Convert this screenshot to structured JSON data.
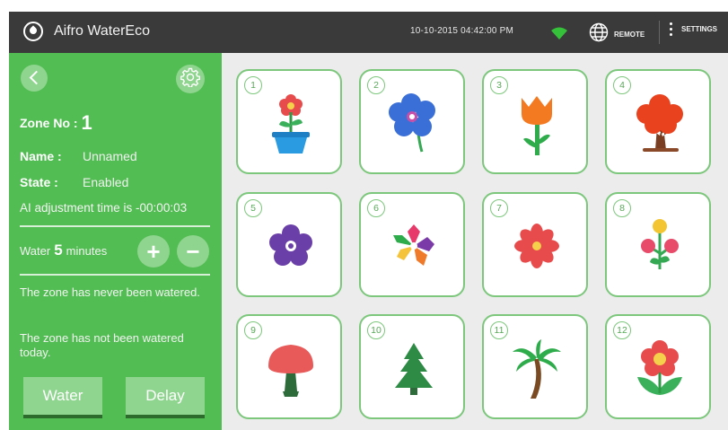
{
  "header": {
    "app_name": "Aifro WaterEco",
    "datetime": "10-10-2015  04:42:00  PM",
    "remote_label": "REMOTE",
    "settings_label": "SETTINGS"
  },
  "zone_panel": {
    "zone_label": "Zone No :",
    "zone_number": "1",
    "name_label": "Name :",
    "name_value": "Unnamed",
    "state_label": "State :",
    "state_value": "Enabled",
    "adjustment_text": "AI adjustment time is -00:00:03",
    "water_prefix": "Water",
    "water_minutes": "5",
    "water_suffix": "minutes",
    "plus_label": "+",
    "minus_label": "−",
    "never_watered_msg": "The zone has never been watered.",
    "not_today_msg": "The zone has not been watered today.",
    "water_button": "Water",
    "delay_button": "Delay"
  },
  "zones": [
    {
      "number": "1",
      "icon": "potted-flower-icon"
    },
    {
      "number": "2",
      "icon": "blue-flower-icon"
    },
    {
      "number": "3",
      "icon": "tulip-icon"
    },
    {
      "number": "4",
      "icon": "autumn-tree-icon"
    },
    {
      "number": "5",
      "icon": "purple-flower-icon"
    },
    {
      "number": "6",
      "icon": "star-flower-icon"
    },
    {
      "number": "7",
      "icon": "red-daisy-icon"
    },
    {
      "number": "8",
      "icon": "bud-flowers-icon"
    },
    {
      "number": "9",
      "icon": "mushroom-tree-icon"
    },
    {
      "number": "10",
      "icon": "pine-tree-icon"
    },
    {
      "number": "11",
      "icon": "palm-tree-icon"
    },
    {
      "number": "12",
      "icon": "red-flower-icon"
    }
  ],
  "colors": {
    "panel_green": "#52bd52",
    "button_green": "#8fd58f",
    "tile_border": "#7cc77c",
    "topbar": "#3a3a3a",
    "wifi_green": "#35c23a"
  }
}
